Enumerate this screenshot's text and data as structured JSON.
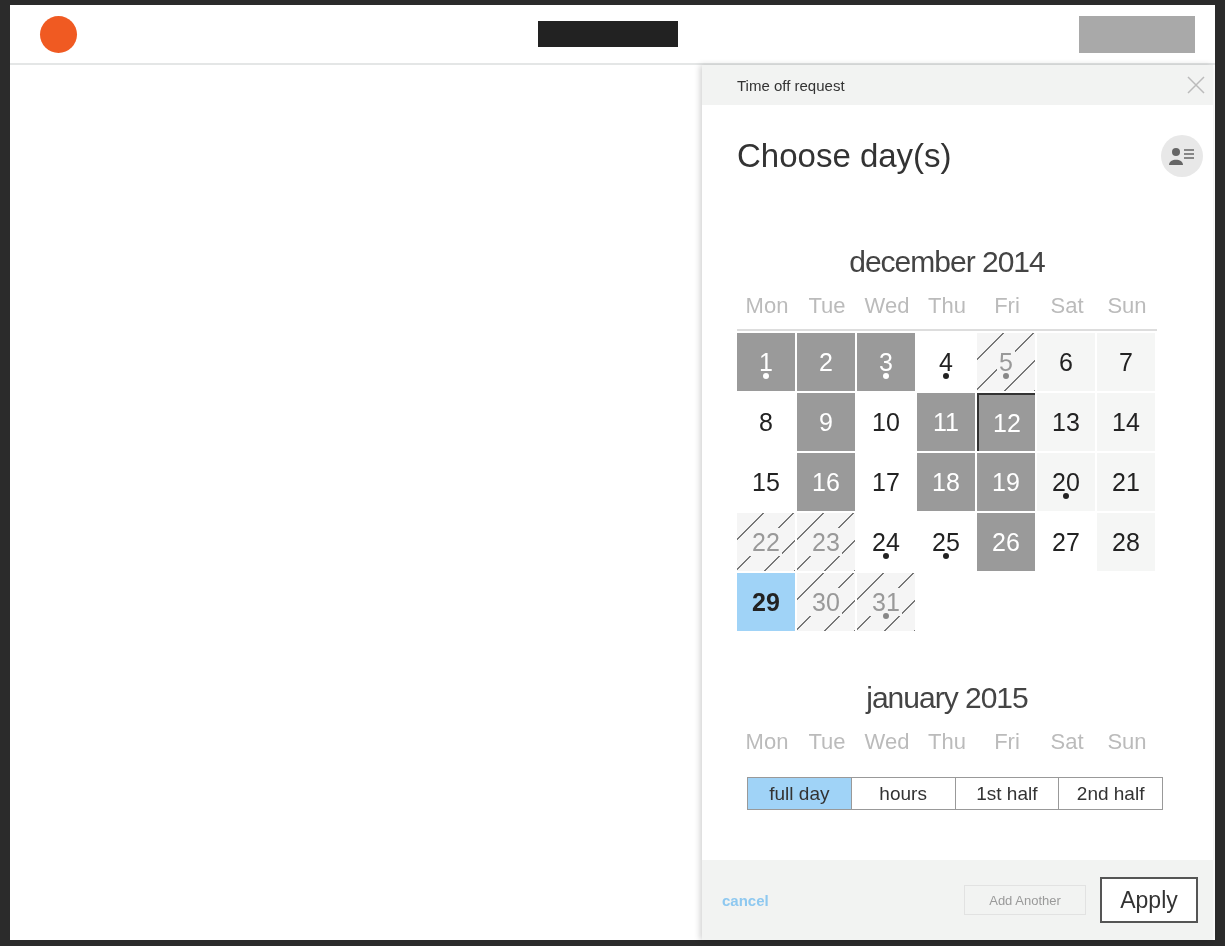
{
  "dialog": {
    "title": "Time off request",
    "heading": "Choose day(s)"
  },
  "months": [
    {
      "title": "december 2014",
      "weekdays": [
        "Mon",
        "Tue",
        "Wed",
        "Thu",
        "Fri",
        "Sat",
        "Sun"
      ],
      "days": [
        {
          "label": "1",
          "kind": "booked",
          "marked": true,
          "selected": false
        },
        {
          "label": "2",
          "kind": "booked",
          "marked": false,
          "selected": false
        },
        {
          "label": "3",
          "kind": "booked",
          "marked": true,
          "selected": false
        },
        {
          "label": "4",
          "kind": "workday",
          "marked": true,
          "selected": false
        },
        {
          "label": "5",
          "kind": "holiday",
          "marked": true,
          "selected": false
        },
        {
          "label": "6",
          "kind": "weekend",
          "marked": false,
          "selected": false
        },
        {
          "label": "7",
          "kind": "weekend",
          "marked": false,
          "selected": false
        },
        {
          "label": "8",
          "kind": "workday",
          "marked": false,
          "selected": false
        },
        {
          "label": "9",
          "kind": "booked",
          "marked": false,
          "selected": false
        },
        {
          "label": "10",
          "kind": "workday",
          "marked": false,
          "selected": false
        },
        {
          "label": "11",
          "kind": "booked",
          "marked": false,
          "selected": false
        },
        {
          "label": "12",
          "kind": "booked",
          "marked": false,
          "selected": false,
          "focused": true
        },
        {
          "label": "13",
          "kind": "weekend",
          "marked": false,
          "selected": false
        },
        {
          "label": "14",
          "kind": "weekend",
          "marked": false,
          "selected": false
        },
        {
          "label": "15",
          "kind": "workday",
          "marked": false,
          "selected": false
        },
        {
          "label": "16",
          "kind": "booked",
          "marked": false,
          "selected": false
        },
        {
          "label": "17",
          "kind": "workday",
          "marked": false,
          "selected": false
        },
        {
          "label": "18",
          "kind": "booked",
          "marked": false,
          "selected": false
        },
        {
          "label": "19",
          "kind": "booked",
          "marked": false,
          "selected": false
        },
        {
          "label": "20",
          "kind": "weekend",
          "marked": true,
          "selected": false
        },
        {
          "label": "21",
          "kind": "weekend",
          "marked": false,
          "selected": false
        },
        {
          "label": "22",
          "kind": "holiday",
          "marked": false,
          "selected": false
        },
        {
          "label": "23",
          "kind": "holiday",
          "marked": false,
          "selected": false
        },
        {
          "label": "24",
          "kind": "workday",
          "marked": true,
          "selected": false
        },
        {
          "label": "25",
          "kind": "workday",
          "marked": true,
          "selected": false
        },
        {
          "label": "26",
          "kind": "booked",
          "marked": false,
          "selected": false
        },
        {
          "label": "27",
          "kind": "workday",
          "marked": false,
          "selected": false
        },
        {
          "label": "28",
          "kind": "weekend",
          "marked": false,
          "selected": false
        },
        {
          "label": "29",
          "kind": "workday",
          "marked": false,
          "selected": true
        },
        {
          "label": "30",
          "kind": "holiday",
          "marked": false,
          "selected": false
        },
        {
          "label": "31",
          "kind": "holiday",
          "marked": true,
          "selected": false
        }
      ]
    },
    {
      "title": "january 2015",
      "weekdays": [
        "Mon",
        "Tue",
        "Wed",
        "Thu",
        "Fri",
        "Sat",
        "Sun"
      ]
    }
  ],
  "duration_options": [
    {
      "label": "full day",
      "selected": true
    },
    {
      "label": "hours",
      "selected": false
    },
    {
      "label": "1st half",
      "selected": false
    },
    {
      "label": "2nd half",
      "selected": false
    }
  ],
  "footer": {
    "cancel": "cancel",
    "add_another": {
      "label": "Add Another",
      "disabled": true
    },
    "apply": "Apply"
  }
}
